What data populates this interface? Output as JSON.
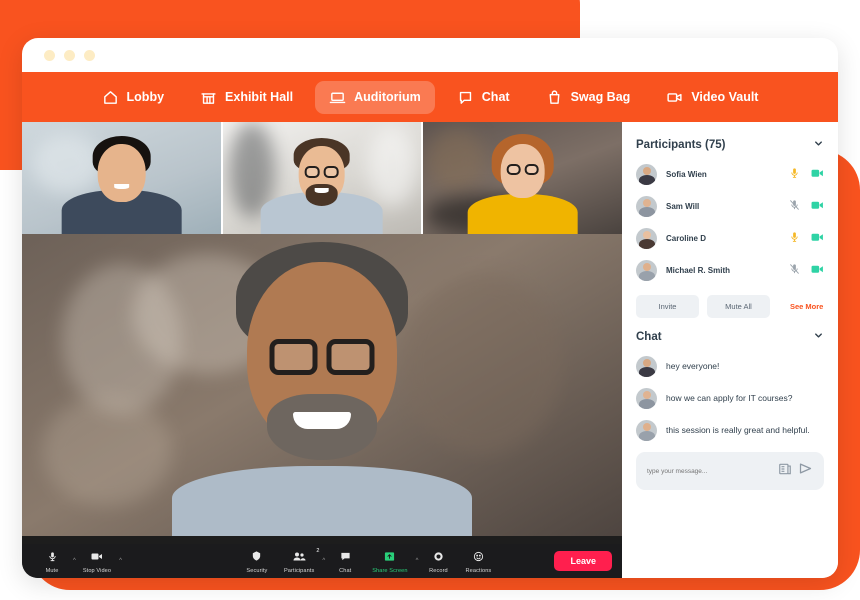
{
  "window": {
    "traffic_lights": [
      "dot-1",
      "dot-2",
      "dot-3"
    ]
  },
  "nav": {
    "items": [
      {
        "label": "Lobby",
        "icon": "home-icon",
        "active": false
      },
      {
        "label": "Exhibit Hall",
        "icon": "storefront-icon",
        "active": false
      },
      {
        "label": "Auditorium",
        "icon": "laptop-icon",
        "active": true
      },
      {
        "label": "Chat",
        "icon": "chat-bubble-icon",
        "active": false
      },
      {
        "label": "Swag Bag",
        "icon": "shopping-bag-icon",
        "active": false
      },
      {
        "label": "Video Vault",
        "icon": "video-camera-icon",
        "active": false
      }
    ]
  },
  "stage": {
    "thumbnails": [
      {
        "name": "thumbnail-participant-1"
      },
      {
        "name": "thumbnail-participant-2"
      },
      {
        "name": "thumbnail-participant-3"
      }
    ],
    "main_speaker": "main-speaker-video"
  },
  "toolbar": {
    "items": [
      {
        "label": "Mute",
        "icon": "microphone-icon",
        "caret": true,
        "badge": ""
      },
      {
        "label": "Stop Video",
        "icon": "video-camera-icon",
        "caret": true,
        "badge": ""
      },
      {
        "label": "Security",
        "icon": "shield-icon",
        "caret": false,
        "badge": ""
      },
      {
        "label": "Participants",
        "icon": "participants-icon",
        "caret": true,
        "badge": "2"
      },
      {
        "label": "Chat",
        "icon": "chat-bubble-icon",
        "caret": false,
        "badge": ""
      },
      {
        "label": "Share Screen",
        "icon": "share-screen-icon",
        "caret": true,
        "badge": ""
      },
      {
        "label": "Record",
        "icon": "record-icon",
        "caret": false,
        "badge": ""
      },
      {
        "label": "Reactions",
        "icon": "reactions-icon",
        "caret": false,
        "badge": ""
      }
    ],
    "leave_label": "Leave"
  },
  "participants": {
    "title": "Participants (75)",
    "count": 75,
    "rows": [
      {
        "name": "Sofia Wien",
        "mic": "on",
        "video": "on"
      },
      {
        "name": "Sam Will",
        "mic": "off",
        "video": "on"
      },
      {
        "name": "Caroline D",
        "mic": "on",
        "video": "on"
      },
      {
        "name": "Michael R. Smith",
        "mic": "off",
        "video": "on"
      }
    ],
    "invite_label": "Invite",
    "mute_all_label": "Mute All",
    "see_more_label": "See More"
  },
  "chat": {
    "title": "Chat",
    "messages": [
      {
        "text": "hey everyone!"
      },
      {
        "text": "how we can apply for IT courses?"
      },
      {
        "text": "this session is really great and helpful."
      }
    ],
    "composer": {
      "placeholder": "type your message...",
      "attach_icon": "document-icon",
      "send_icon": "send-icon"
    }
  },
  "colors": {
    "brand_orange": "#f9531f",
    "active_pill": "#fa7a52",
    "leave_red": "#ff1f4e",
    "mic_on": "#f5b827",
    "mic_off": "#9aa3ab",
    "video_on": "#2fd3a5",
    "share_green": "#29d07a",
    "text_dark": "#31404d"
  }
}
